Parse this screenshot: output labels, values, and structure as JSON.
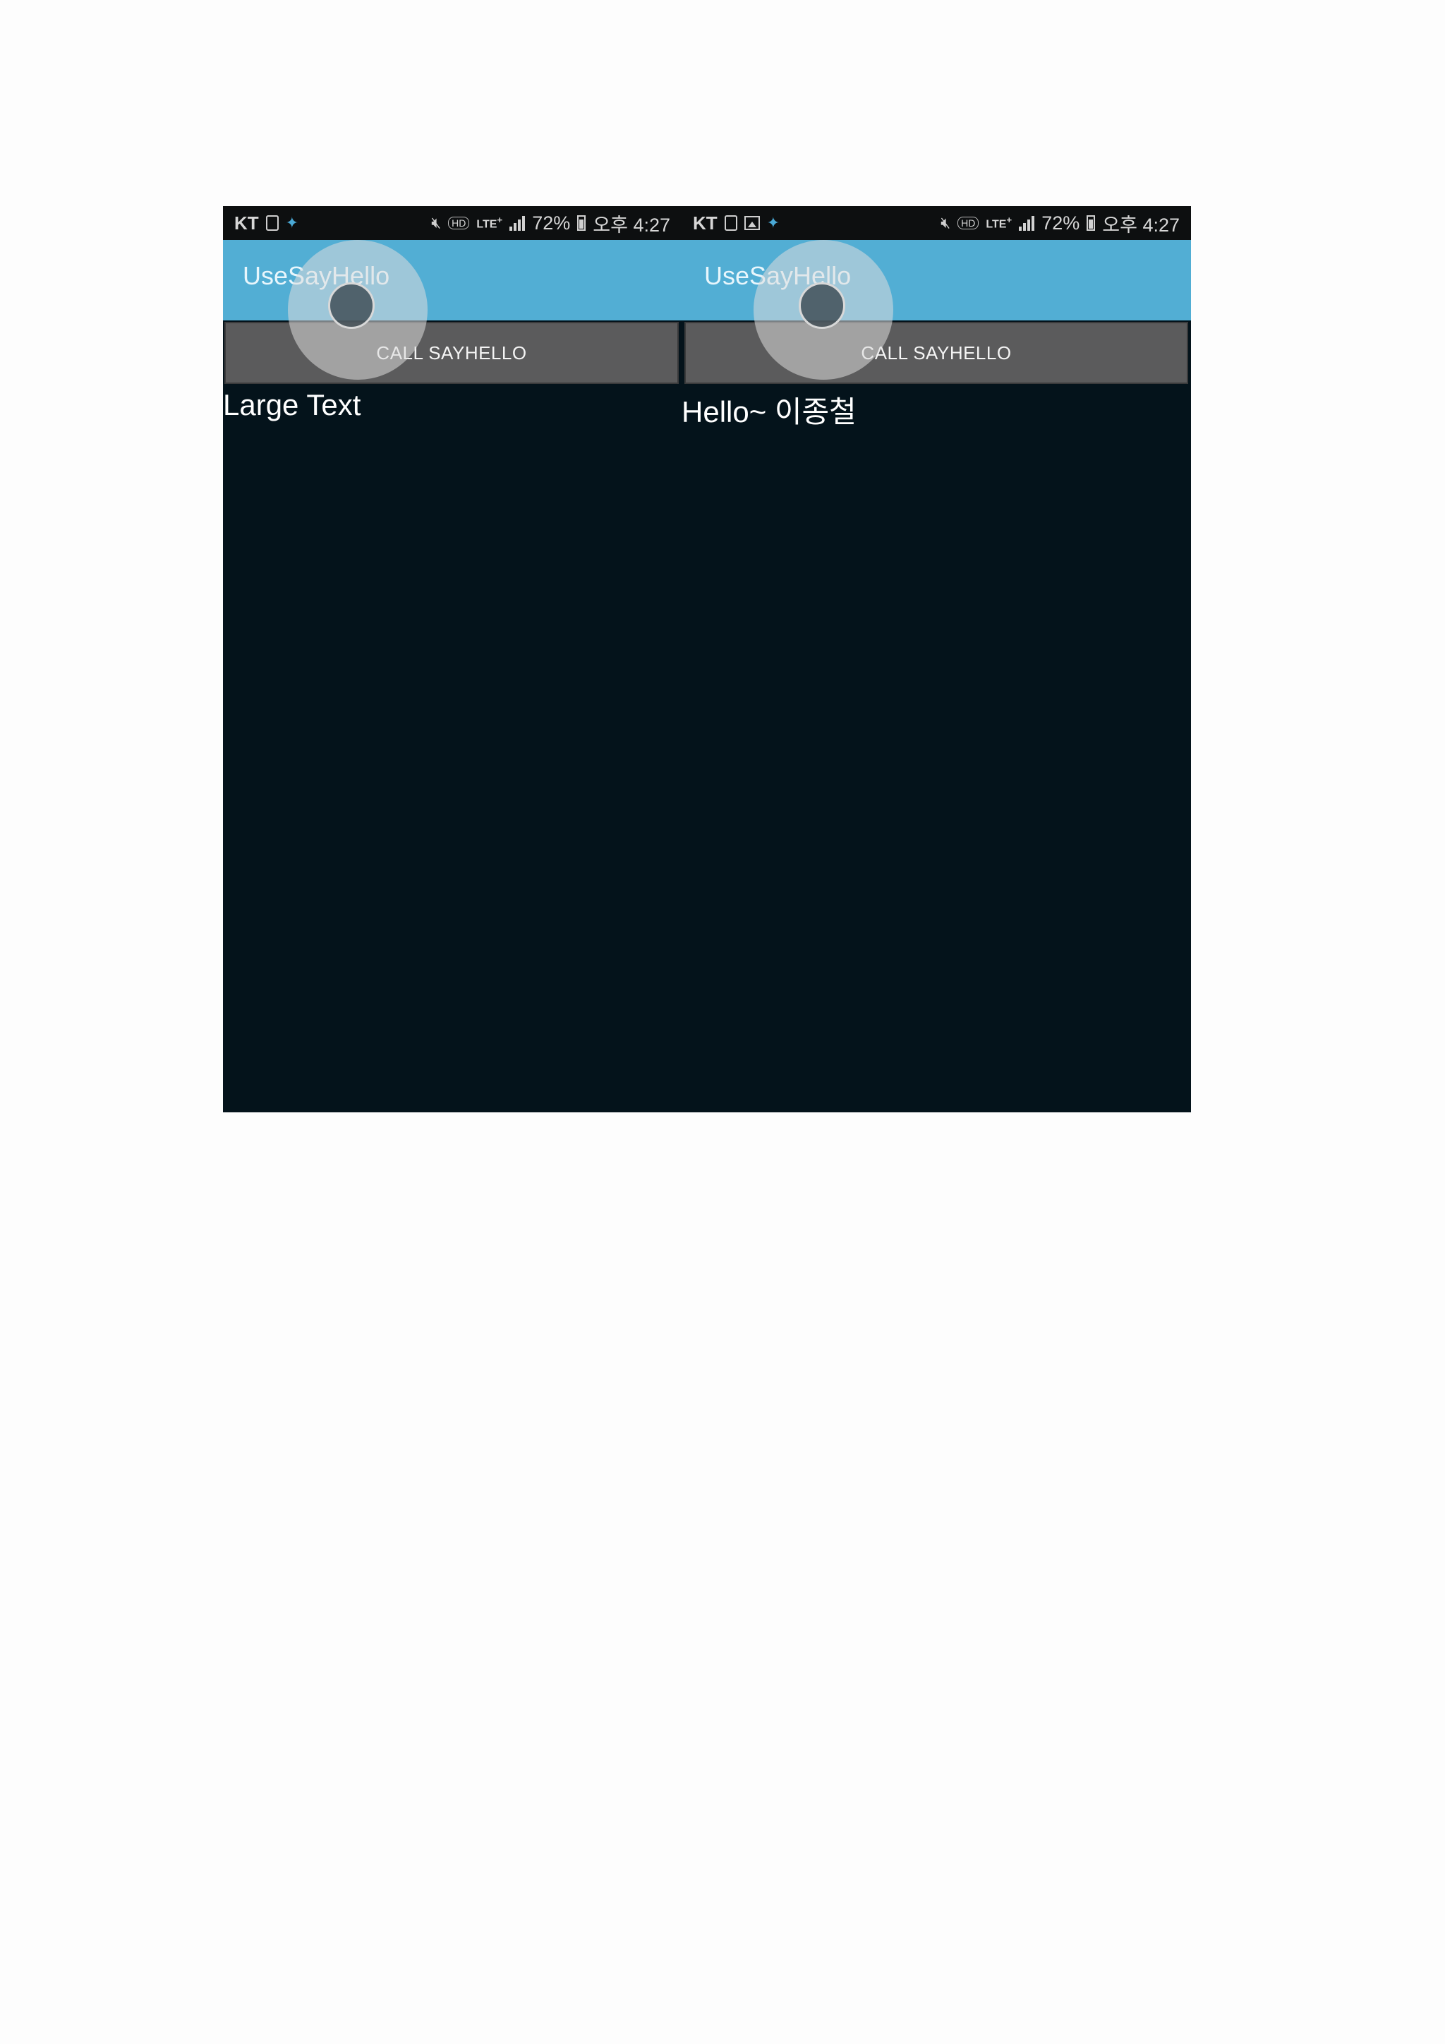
{
  "screens": [
    {
      "status_bar": {
        "carrier": "KT",
        "battery": "72%",
        "time": "오후 4:27",
        "network": "LTE",
        "network_sup": "+",
        "hd_label": "HD",
        "icons": [
          "sim-icon",
          "bird-icon",
          "mute-icon",
          "hd-icon",
          "lte-icon",
          "signal-icon",
          "battery-icon"
        ]
      },
      "app_title": "UseSayHello",
      "button_label": "CALL SAYHELLO",
      "result_text": "Large Text"
    },
    {
      "status_bar": {
        "carrier": "KT",
        "battery": "72%",
        "time": "오후 4:27",
        "network": "LTE",
        "network_sup": "+",
        "hd_label": "HD",
        "icons": [
          "sim-icon",
          "image-icon",
          "bird-icon",
          "mute-icon",
          "hd-icon",
          "lte-icon",
          "signal-icon",
          "battery-icon"
        ]
      },
      "app_title": "UseSayHello",
      "button_label": "CALL SAYHELLO",
      "result_text": "Hello~ 이종철"
    }
  ],
  "colors": {
    "app_bar": "#52aed4",
    "screen_bg": "#04131b",
    "button_bg": "#5b5b5c",
    "status_bar_bg": "#0d0f10",
    "page_bg": "#fdfdfd"
  }
}
